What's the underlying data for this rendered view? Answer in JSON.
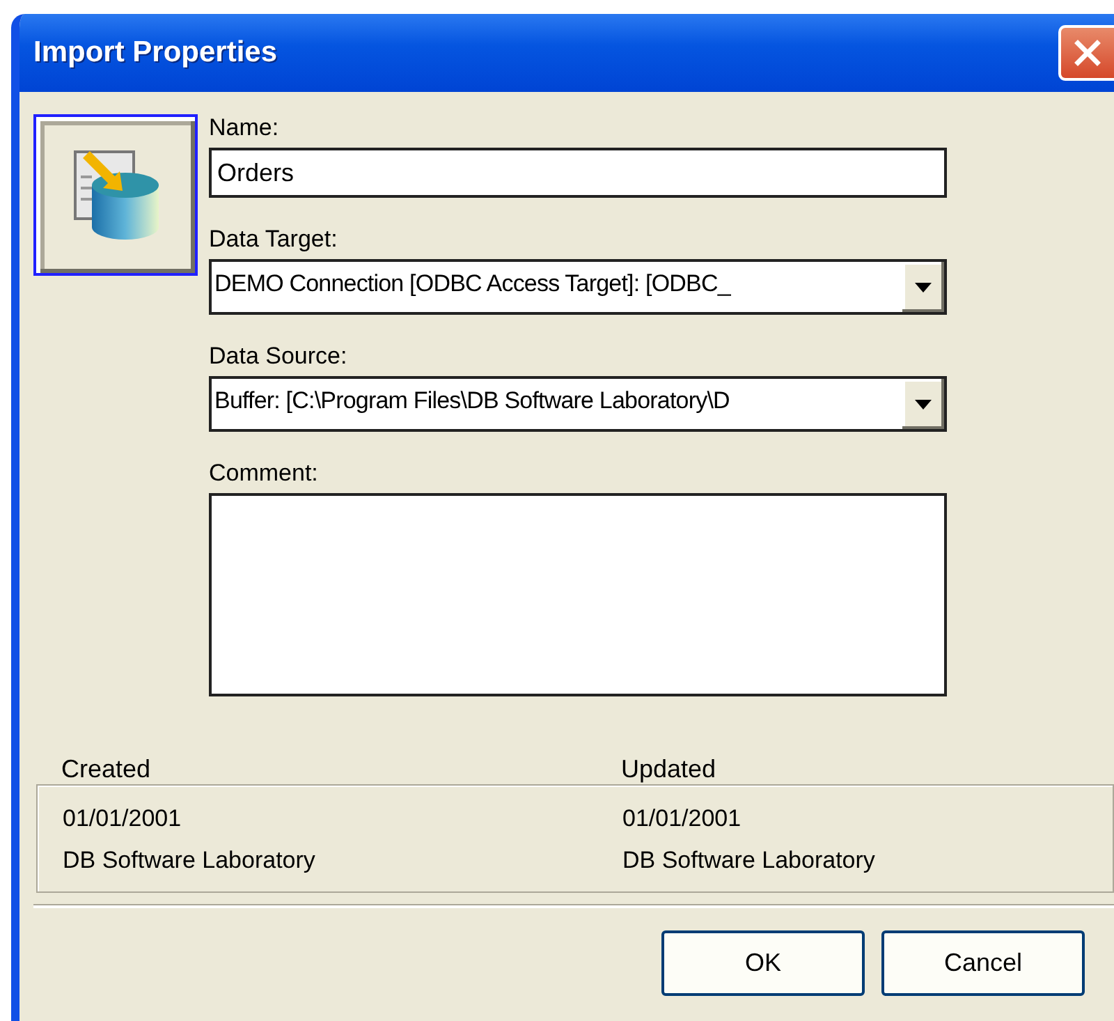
{
  "window": {
    "title": "Import Properties"
  },
  "fields": [
    {
      "kind": "text",
      "label": "Name:",
      "value": "Orders"
    },
    {
      "kind": "select",
      "label": "Data Target:",
      "value": "DEMO Connection [ODBC Access Target]: [ODBC_"
    },
    {
      "kind": "select",
      "label": "Data Source:",
      "value": "Buffer: [C:\\Program Files\\DB Software Laboratory\\D"
    },
    {
      "kind": "textarea",
      "label": "Comment:"
    }
  ],
  "history": [
    {
      "label": "Created",
      "date": "01/01/2001",
      "author": "DB Software Laboratory"
    },
    {
      "label": "Updated",
      "date": "01/01/2001",
      "author": "DB Software Laboratory"
    }
  ],
  "buttons": [
    "OK",
    "Cancel"
  ]
}
